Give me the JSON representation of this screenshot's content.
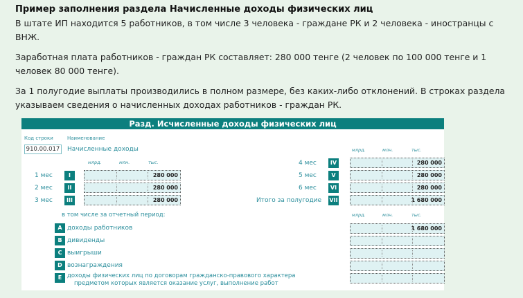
{
  "article": {
    "title": "Пример заполнения раздела Начисленные доходы физических лиц",
    "p1": "В штате ИП находится 5 работников, в том числе 3 человека - граждане РК и 2 человека - иностранцы с ВНЖ.",
    "p2": "Заработная плата работников - граждан РК составляет: 280 000 тенге (2 человек по 100 000 тенге и 1 человек 80 000 тенге).",
    "p3": "За 1 полугодие выплаты производились в полном размере, без каких-либо отклонений. В строках раздела указываем сведения о начисленных доходах работников - граждан РК."
  },
  "form": {
    "header": "Разд. Исчисленные доходы физических лиц",
    "col_code": "Код строки",
    "col_name": "Наименование",
    "row_code": "910.00.017",
    "row_name": "Начисленные доходы",
    "units": {
      "mlrd": "млрд.",
      "mln": "млн.",
      "tys": "тыс."
    },
    "months_left": [
      {
        "label": "1 мес",
        "badge": "I",
        "value": "280 000"
      },
      {
        "label": "2 мес",
        "badge": "II",
        "value": "280 000"
      },
      {
        "label": "3 мес",
        "badge": "III",
        "value": "280 000"
      }
    ],
    "months_right": [
      {
        "label": "4 мес",
        "badge": "IV",
        "value": "280 000"
      },
      {
        "label": "5 мес",
        "badge": "V",
        "value": "280 000"
      },
      {
        "label": "6 мес",
        "badge": "VI",
        "value": "280 000"
      },
      {
        "label": "Итого за полугодие",
        "badge": "VII",
        "value": "1 680 000"
      }
    ],
    "including_label": "в том числе за отчетный период:",
    "breakdown": [
      {
        "badge": "A",
        "label": "доходы работников",
        "value": "1 680 000"
      },
      {
        "badge": "B",
        "label": "дивиденды",
        "value": ""
      },
      {
        "badge": "C",
        "label": "выигрыши",
        "value": ""
      },
      {
        "badge": "D",
        "label": "вознаграждения",
        "value": ""
      },
      {
        "badge": "E",
        "label": "доходы физических лиц по договорам гражданско-правового характера",
        "label2": "предметом которых является оказание услуг, выполнение работ",
        "value": ""
      }
    ]
  }
}
